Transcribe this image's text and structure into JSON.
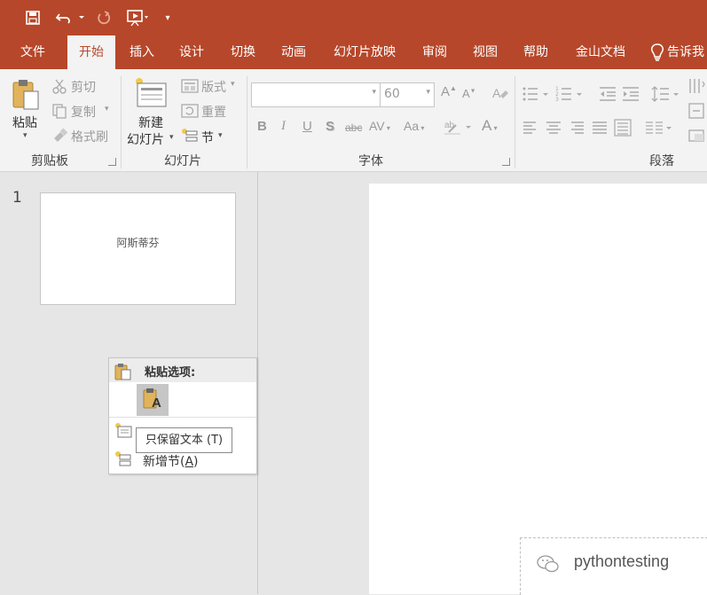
{
  "quick_access": {
    "more": "▾"
  },
  "tabs": [
    {
      "label": "文件"
    },
    {
      "label": "开始"
    },
    {
      "label": "插入"
    },
    {
      "label": "设计"
    },
    {
      "label": "切换"
    },
    {
      "label": "动画"
    },
    {
      "label": "幻灯片放映"
    },
    {
      "label": "审阅"
    },
    {
      "label": "视图"
    },
    {
      "label": "帮助"
    },
    {
      "label": "金山文档"
    },
    {
      "label": "告诉我"
    }
  ],
  "ribbon": {
    "clipboard": {
      "paste": "粘贴",
      "cut": "剪切",
      "copy": "复制",
      "format_painter": "格式刷",
      "group": "剪贴板"
    },
    "slides": {
      "new_slide_line1": "新建",
      "new_slide_line2": "幻灯片",
      "layout": "版式",
      "reset": "重置",
      "section": "节",
      "group": "幻灯片"
    },
    "font": {
      "font_name": "",
      "font_size": "60",
      "bold": "B",
      "italic": "I",
      "underline": "U",
      "shadow": "S",
      "strike": "abc",
      "spacing": "AV",
      "case": "Aa",
      "color": "A",
      "grow": "A",
      "shrink": "A",
      "group": "字体"
    },
    "paragraph": {
      "group": "段落"
    }
  },
  "thumbnails": [
    {
      "number": "1",
      "text": "阿斯蒂芬"
    }
  ],
  "context_menu": {
    "header": "粘贴选项:",
    "paste_icon_letter": "A",
    "tooltip": "只保留文本 (T)",
    "item_new_section_main": "新增节(",
    "item_new_section_key": "A",
    "item_new_section_end": ")"
  },
  "watermark": {
    "text": "pythontesting"
  },
  "colors": {
    "accent": "#b7472a",
    "ribbon_bg": "#f3f3f3",
    "pane_bg": "#e6e6e6"
  }
}
